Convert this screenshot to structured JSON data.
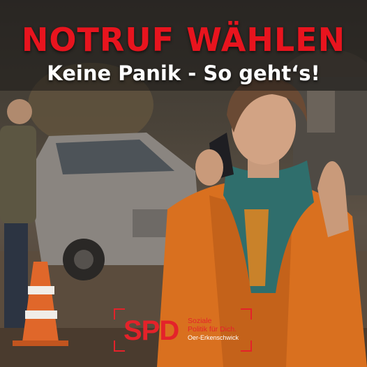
{
  "headline": "NOTRUF WÄHLEN",
  "subline": "Keine Panik - So geht‘s!",
  "logo": {
    "mark": "SPD",
    "tagline_1": "Soziale",
    "tagline_2": "Politik für Dich.",
    "location": "Oer-Erkenschwick"
  },
  "colors": {
    "accent": "#e4222a",
    "headline": "#e8141e",
    "jacket": "#d9701f"
  },
  "scene": {
    "icons": [
      "woman-on-phone",
      "damaged-car",
      "traffic-cone",
      "bystander"
    ]
  }
}
